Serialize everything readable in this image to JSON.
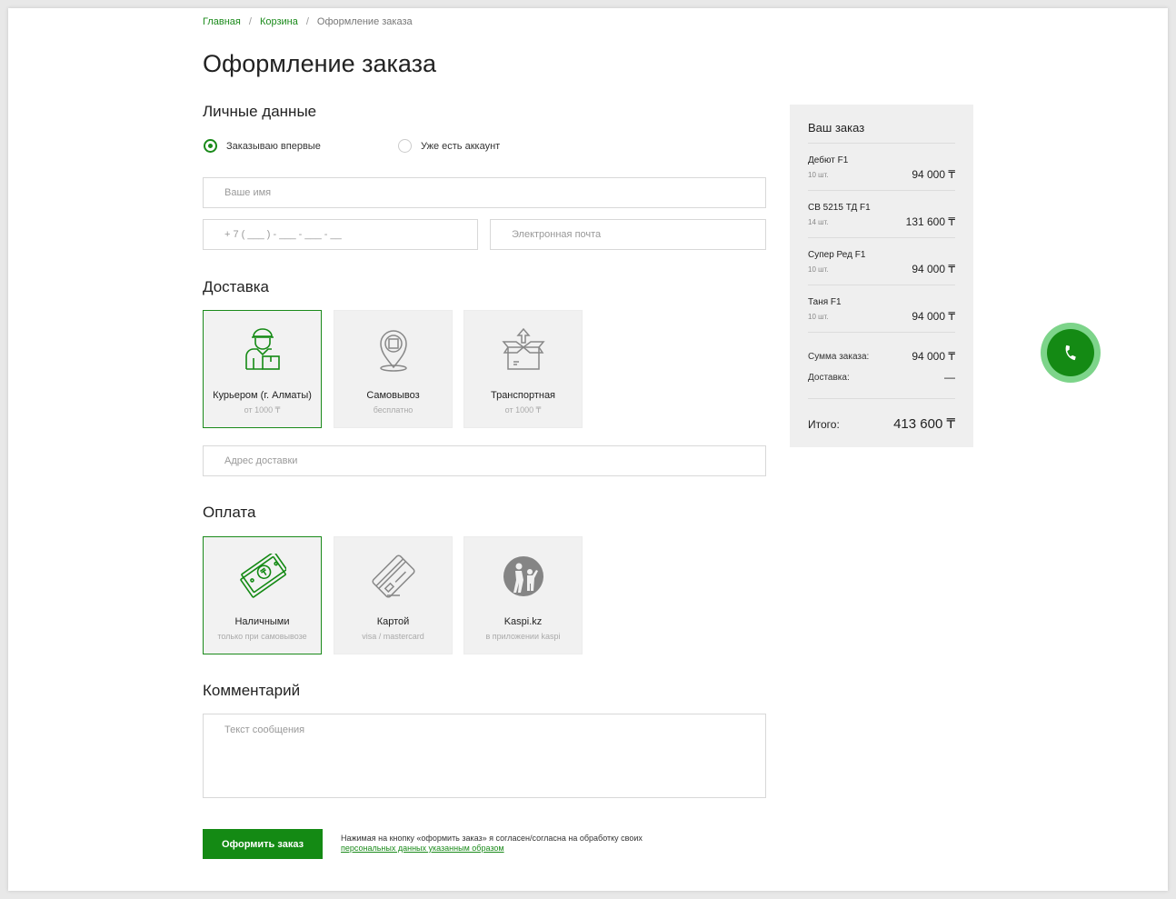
{
  "breadcrumb": {
    "home": "Главная",
    "cart": "Корзина",
    "current": "Оформление заказа",
    "separator": "/"
  },
  "page_title": "Оформление заказа",
  "personal": {
    "title": "Личные данные",
    "radio_new": "Заказываю впервые",
    "radio_existing": "Уже есть аккаунт",
    "name_placeholder": "Ваше имя",
    "phone_placeholder": "+ 7 ( ___ ) - ___ - ___ - __",
    "email_placeholder": "Электронная почта"
  },
  "delivery": {
    "title": "Доставка",
    "options": [
      {
        "title": "Курьером (г. Алматы)",
        "sub": "от 1000 ₸",
        "icon": "courier-icon"
      },
      {
        "title": "Самовывоз",
        "sub": "бесплатно",
        "icon": "pickup-pin-icon"
      },
      {
        "title": "Транспортная",
        "sub": "от 1000 ₸",
        "icon": "box-icon"
      }
    ],
    "address_placeholder": "Адрес доставки"
  },
  "payment": {
    "title": "Оплата",
    "options": [
      {
        "title": "Наличными",
        "sub": "только при самовывозе",
        "icon": "cash-icon"
      },
      {
        "title": "Картой",
        "sub": "visa / mastercard",
        "icon": "card-icon"
      },
      {
        "title": "Kaspi.kz",
        "sub": "в приложении kaspi",
        "icon": "kaspi-icon"
      }
    ]
  },
  "comment": {
    "title": "Комментарий",
    "placeholder": "Текст сообщения"
  },
  "submit_label": "Оформить заказ",
  "consent": {
    "text": "Нажимая на кнопку «оформить заказ» я согласен/согласна на обработку своих",
    "link": "персональных данных указанным образом"
  },
  "summary": {
    "title": "Ваш заказ",
    "items": [
      {
        "name": "Дебют F1",
        "qty": "10 шт.",
        "price": "94 000 ₸"
      },
      {
        "name": "СВ 5215 ТД F1",
        "qty": "14 шт.",
        "price": "131 600 ₸"
      },
      {
        "name": "Супер Ред F1",
        "qty": "10 шт.",
        "price": "94 000 ₸"
      },
      {
        "name": "Таня F1",
        "qty": "10 шт.",
        "price": "94 000 ₸"
      }
    ],
    "sum_label": "Сумма заказа:",
    "sum_value": "94 000 ₸",
    "delivery_label": "Доставка:",
    "delivery_value": "—",
    "total_label": "Итого:",
    "total_value": "413 600 ₸"
  },
  "colors": {
    "accent": "#148a14",
    "accent_light": "#7dd48a",
    "panel": "#efefef"
  },
  "fab_icon": "phone-icon"
}
